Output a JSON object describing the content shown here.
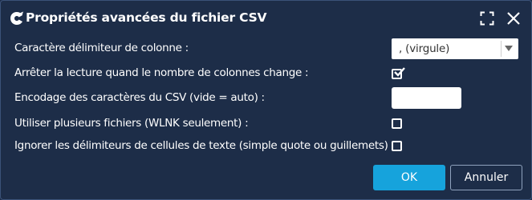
{
  "dialog": {
    "title": "Propriétés avancées du fichier CSV",
    "icons": {
      "app": "app-logo-icon",
      "maximize": "maximize-icon",
      "close": "close-icon"
    }
  },
  "fields": {
    "delimiter": {
      "label": "Caractère délimiteur de colonne :",
      "value": ", (virgule)"
    },
    "stop_reading": {
      "label": "Arrêter la lecture quand le nombre de colonnes change :",
      "checked": true
    },
    "encoding": {
      "label": "Encodage des caractères du CSV (vide = auto) :",
      "value": ""
    },
    "multiple_files": {
      "label": "Utiliser plusieurs fichiers (WLNK seulement) :",
      "checked": false
    },
    "ignore_delimiters": {
      "label": "Ignorer les délimiteurs de cellules de texte (simple quote ou guillemets)",
      "checked": false
    }
  },
  "buttons": {
    "ok": "OK",
    "cancel": "Annuler"
  },
  "colors": {
    "background": "#1d2d48",
    "accent": "#16a3dc",
    "text": "#ffffff"
  }
}
